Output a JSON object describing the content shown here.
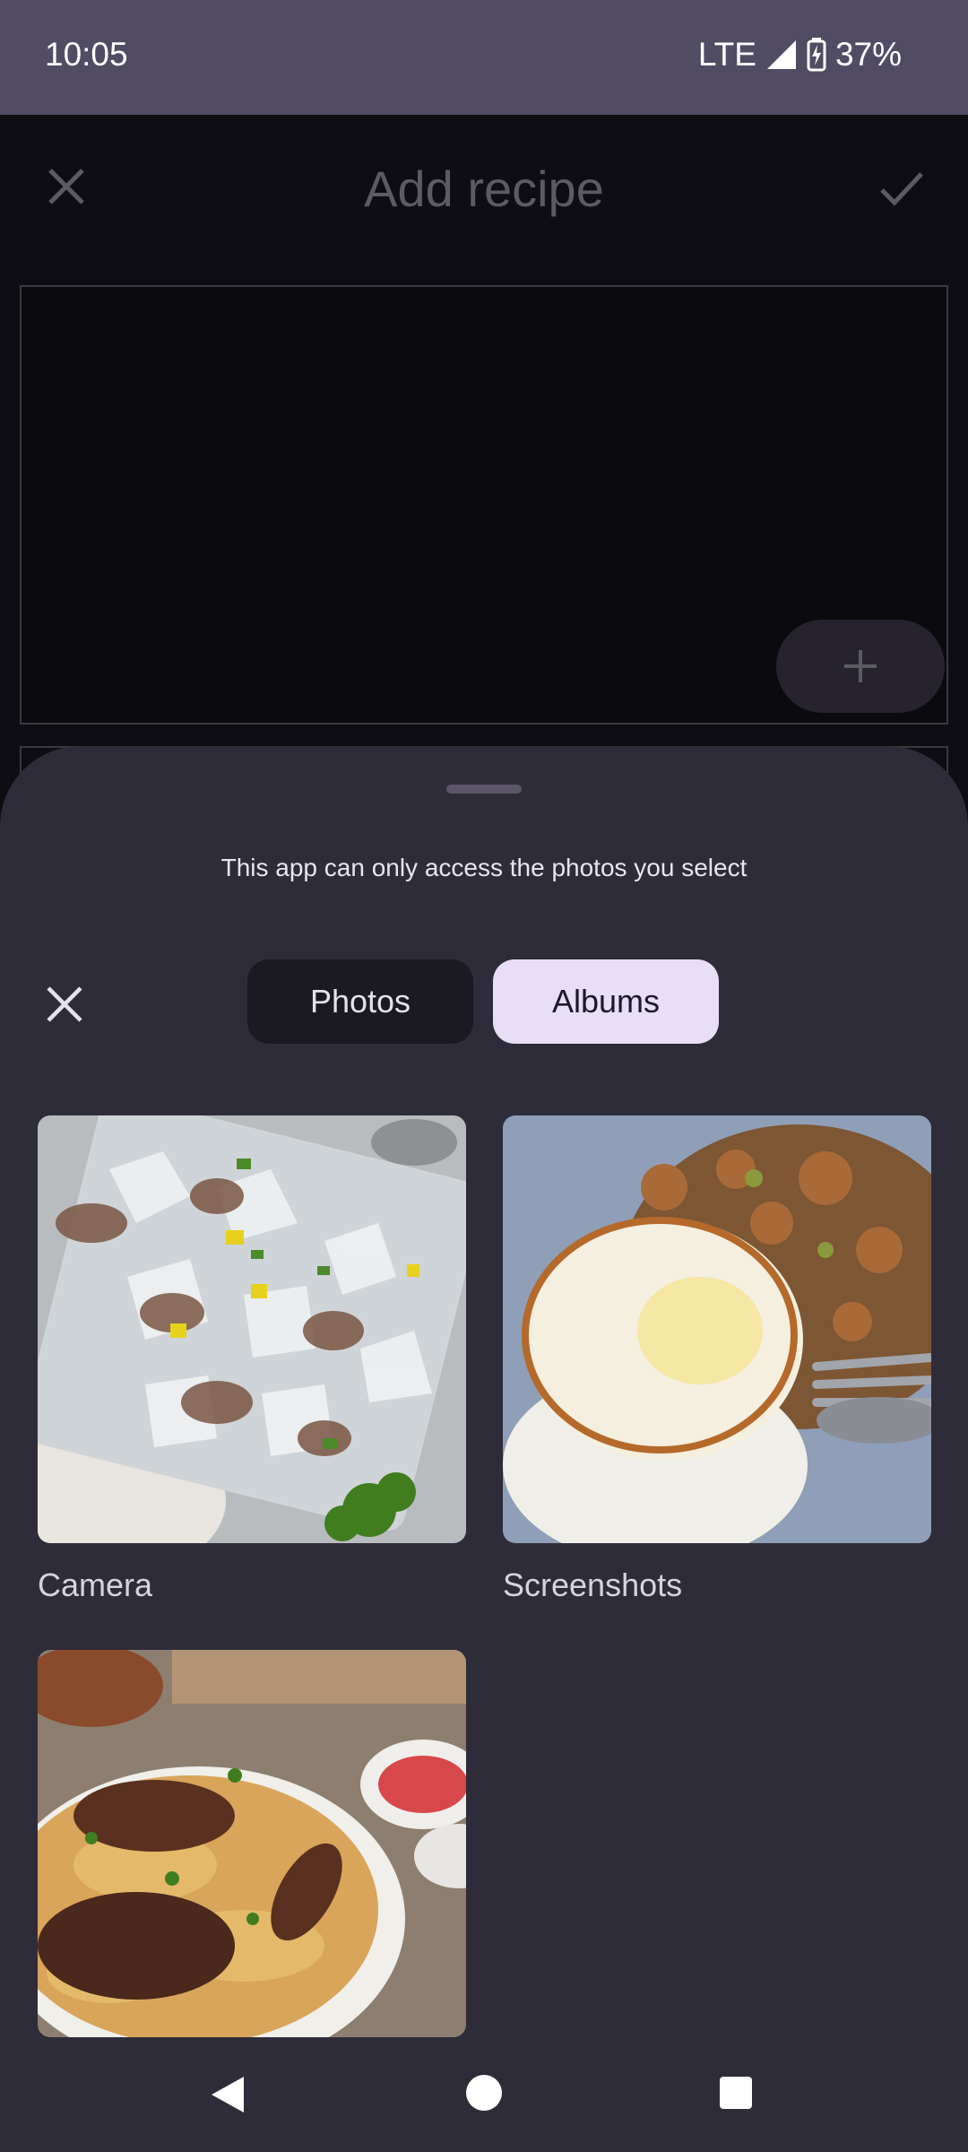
{
  "status_bar": {
    "time": "10:05",
    "network": "LTE",
    "battery": "37%",
    "icons": [
      "signal-icon",
      "battery-charging-icon"
    ]
  },
  "app": {
    "title": "Add recipe",
    "icons": [
      "close-icon",
      "check-icon",
      "add-icon"
    ]
  },
  "picker": {
    "caption": "This app can only access the photos you select",
    "tabs": [
      {
        "label": "Photos",
        "selected": false
      },
      {
        "label": "Albums",
        "selected": true
      }
    ],
    "albums": [
      {
        "label": "Camera",
        "thumbnail": "ice-tray-food-photo"
      },
      {
        "label": "Screenshots",
        "thumbnail": "fried-egg-rice-photo"
      },
      {
        "label": "",
        "thumbnail": "biryani-chicken-photo"
      }
    ]
  },
  "nav": {
    "icons": [
      "back-icon",
      "home-icon",
      "recents-icon"
    ]
  },
  "colors": {
    "status_bar": "#514c64",
    "sheet": "#2f2c39",
    "tab_selected": "#e8def8",
    "tab_unselected": "#1b1a22"
  }
}
